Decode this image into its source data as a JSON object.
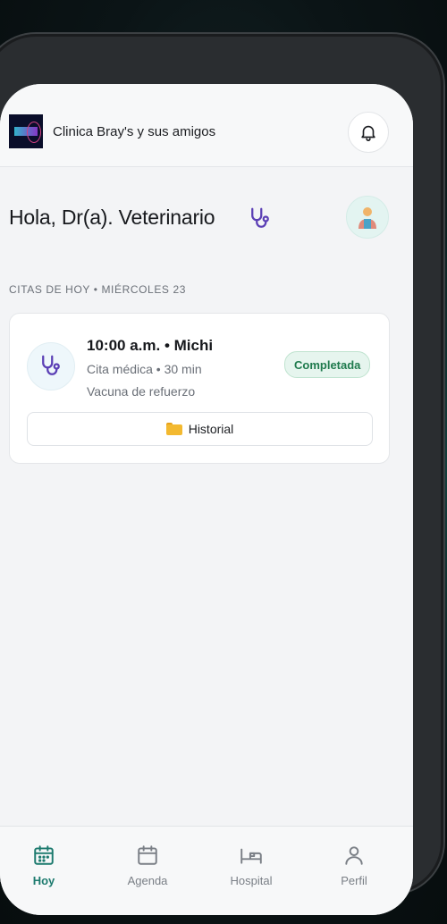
{
  "header": {
    "clinic_name": "Clinica Bray's y sus amigos",
    "logo_icon": "clinic-logo",
    "notification_icon": "bell-icon"
  },
  "greeting": {
    "text": "Hola, Dr(a). Veterinario",
    "icon": "stethoscope-icon",
    "avatar_icon": "doctor-avatar"
  },
  "appointments": {
    "section_label": "CITAS DE HOY • MIÉRCOLES 23",
    "items": [
      {
        "title": "10:00 a.m. • Michi",
        "subtitle": "Cita médica • 30 min",
        "note": "Vacuna de refuerzo",
        "status": "Completada",
        "history_label": "Historial",
        "icon": "stethoscope-icon"
      }
    ]
  },
  "nav": {
    "items": [
      {
        "label": "Hoy",
        "icon": "calendar-today-icon",
        "active": true
      },
      {
        "label": "Agenda",
        "icon": "calendar-icon",
        "active": false
      },
      {
        "label": "Hospital",
        "icon": "bed-icon",
        "active": false
      },
      {
        "label": "Perfil",
        "icon": "user-icon",
        "active": false
      }
    ]
  },
  "colors": {
    "accent": "#1c7a6e",
    "status_ok": "#1f7a4d",
    "stethoscope": "#5b3fb5"
  }
}
